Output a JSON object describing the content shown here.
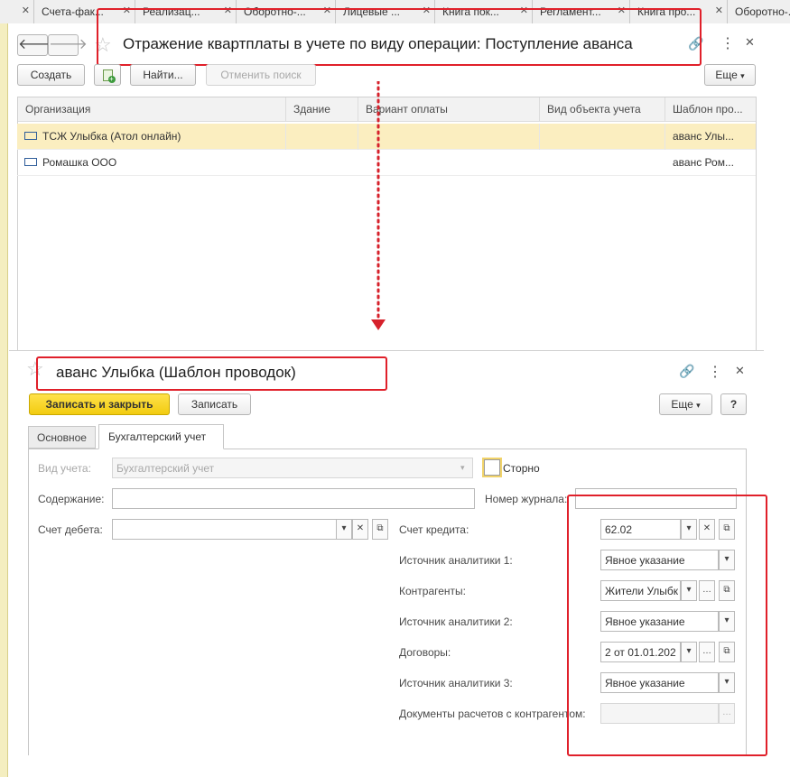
{
  "tabs": [
    {
      "label": "Счета-фак..."
    },
    {
      "label": "Реализац..."
    },
    {
      "label": "Оборотно-..."
    },
    {
      "label": "Лицевые ..."
    },
    {
      "label": "Книга пок..."
    },
    {
      "label": "Регламент..."
    },
    {
      "label": "Книга про..."
    },
    {
      "label": "Оборотно-..."
    }
  ],
  "top_window": {
    "title": "Отражение квартплаты в учете по виду операции: Поступление аванса",
    "buttons": {
      "create": "Создать",
      "find": "Найти...",
      "cancel_search": "Отменить поиск",
      "more": "Еще"
    },
    "columns": [
      "Организация",
      "Здание",
      "Вариант оплаты",
      "Вид объекта учета",
      "Шаблон про..."
    ],
    "rows": [
      {
        "org": "ТСЖ Улыбка (Атол онлайн)",
        "building": "",
        "payment": "",
        "object": "",
        "template": "аванс  Улы..."
      },
      {
        "org": "Ромашка ООО",
        "building": "",
        "payment": "",
        "object": "",
        "template": "аванс  Ром..."
      }
    ]
  },
  "sub_window": {
    "title": "аванс  Улыбка (Шаблон проводок)",
    "buttons": {
      "save_close": "Записать и закрыть",
      "save": "Записать",
      "more": "Еще",
      "help": "?"
    },
    "tabs": [
      "Основное",
      "Бухгалтерский учет"
    ],
    "active_tab": "Бухгалтерский учет",
    "form": {
      "accounting_type_label": "Вид учета:",
      "accounting_type_value": "Бухгалтерский учет",
      "storno_label": "Сторно",
      "storno_checked": false,
      "content_label": "Содержание:",
      "content_value": "",
      "journal_label": "Номер журнала:",
      "journal_value": "",
      "debit_label": "Счет дебета:",
      "debit_value": "",
      "credit_label": "Счет кредита:",
      "credit_value": "62.02",
      "source1_label": "Источник аналитики 1:",
      "source1_value": "Явное указание",
      "contractors_label": "Контрагенты:",
      "contractors_value": "Жители Улыбк",
      "source2_label": "Источник аналитики 2:",
      "source2_value": "Явное указание",
      "contracts_label": "Договоры:",
      "contracts_value": "2 от 01.01.202",
      "source3_label": "Источник аналитики 3:",
      "source3_value": "Явное указание",
      "settlement_docs_label": "Документы расчетов с контрагентом:",
      "settlement_docs_value": ""
    }
  },
  "colors": {
    "accent_red": "#e0202a",
    "selected_row": "#fbeec0",
    "primary_button": "#f5d21a"
  }
}
